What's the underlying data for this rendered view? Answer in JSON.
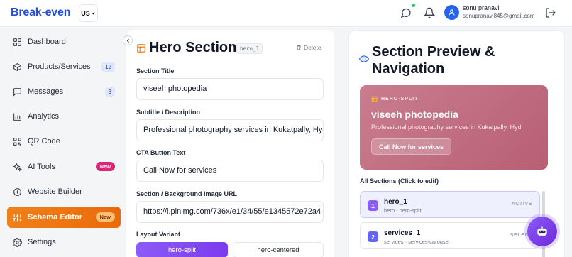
{
  "header": {
    "brand": "Break-even",
    "region": "US",
    "user_name": "sonu pranavi",
    "user_email": "sonupranavi845@gmail.com",
    "icons": [
      "message-circle-icon",
      "bell-icon",
      "user-icon",
      "logout-icon"
    ],
    "notification_dot_color": "#22c55e"
  },
  "sidebar": {
    "items": [
      {
        "label": "Dashboard",
        "icon": "dashboard-grid-icon"
      },
      {
        "label": "Products/Services",
        "icon": "box-icon",
        "count": "12"
      },
      {
        "label": "Messages",
        "icon": "chat-icon",
        "count": "3"
      },
      {
        "label": "Analytics",
        "icon": "bar-chart-icon"
      },
      {
        "label": "QR Code",
        "icon": "qr-code-icon"
      },
      {
        "label": "AI Tools",
        "icon": "sparkles-icon",
        "badge": "New"
      },
      {
        "label": "Website Builder",
        "icon": "plus-circle-icon"
      },
      {
        "label": "Schema Editor",
        "icon": "sliders-icon",
        "badge": "New",
        "active": true
      },
      {
        "label": "Settings",
        "icon": "gear-icon"
      }
    ],
    "active_color": "#f08018"
  },
  "editor": {
    "title": "Hero Section",
    "tag": "hero_1",
    "delete_label": "Delete",
    "fields": {
      "section_title": {
        "label": "Section Title",
        "value": "viseeh photopedia"
      },
      "subtitle": {
        "label": "Subtitle / Description",
        "value": "Professional photography services in Kukatpally, Hyd"
      },
      "cta": {
        "label": "CTA Button Text",
        "value": "Call Now for services"
      },
      "image_url": {
        "label": "Section / Background Image URL",
        "value": "https://i.pinimg.com/736x/e1/34/55/e1345572e72a4"
      }
    },
    "layout_variant": {
      "label": "Layout Variant",
      "options": [
        "hero-split",
        "hero-centered"
      ],
      "selected": "hero-split"
    }
  },
  "preview": {
    "title": "Section Preview & Navigation",
    "hero_card": {
      "tag": "HERO-SPLIT",
      "heading": "viseeh photopedia",
      "subtitle": "Professional photography services in Kukatpally, Hyd",
      "cta": "Call Now for services",
      "bg_color": "#c97d8e"
    },
    "all_sections_label": "All Sections (Click to edit)",
    "sections": [
      {
        "num": "1",
        "name": "hero_1",
        "meta": "hero · hero-split",
        "status": "ACTIVE",
        "color": "#8b5cf6"
      },
      {
        "num": "2",
        "name": "services_1",
        "meta": "services · services-carousel",
        "status": "SELECT",
        "color": "#6366f1"
      }
    ]
  },
  "fab": {
    "icon": "robot-assistant-icon",
    "color": "#7c3aed"
  }
}
